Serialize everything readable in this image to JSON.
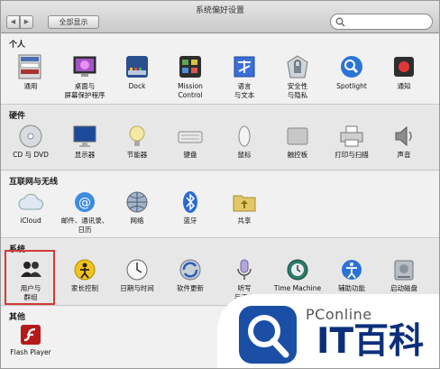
{
  "window": {
    "title": "系统偏好设置",
    "back_glyph": "◀",
    "forward_glyph": "▶",
    "show_all_label": "全部显示"
  },
  "sections": {
    "personal": {
      "title": "个人",
      "items": [
        {
          "label": "通用",
          "icon": "general-icon"
        },
        {
          "label": "桌面与\n屏幕保护程序",
          "icon": "desktop-screensaver-icon"
        },
        {
          "label": "Dock",
          "icon": "dock-icon"
        },
        {
          "label": "Mission\nControl",
          "icon": "mission-control-icon"
        },
        {
          "label": "语言\n与文本",
          "icon": "language-text-icon"
        },
        {
          "label": "安全性\n与隐私",
          "icon": "security-privacy-icon"
        },
        {
          "label": "Spotlight",
          "icon": "spotlight-icon"
        },
        {
          "label": "通知",
          "icon": "notifications-icon"
        }
      ]
    },
    "hardware": {
      "title": "硬件",
      "items": [
        {
          "label": "CD 与 DVD",
          "icon": "cd-dvd-icon"
        },
        {
          "label": "显示器",
          "icon": "displays-icon"
        },
        {
          "label": "节能器",
          "icon": "energy-saver-icon"
        },
        {
          "label": "键盘",
          "icon": "keyboard-icon"
        },
        {
          "label": "鼠标",
          "icon": "mouse-icon"
        },
        {
          "label": "触控板",
          "icon": "trackpad-icon"
        },
        {
          "label": "打印与扫描",
          "icon": "print-scan-icon"
        },
        {
          "label": "声音",
          "icon": "sound-icon"
        }
      ]
    },
    "internet": {
      "title": "互联网与无线",
      "items": [
        {
          "label": "iCloud",
          "icon": "icloud-icon"
        },
        {
          "label": "邮件、通讯录、\n日历",
          "icon": "mail-contacts-calendars-icon"
        },
        {
          "label": "网络",
          "icon": "network-icon"
        },
        {
          "label": "蓝牙",
          "icon": "bluetooth-icon"
        },
        {
          "label": "共享",
          "icon": "sharing-icon"
        }
      ]
    },
    "system": {
      "title": "系统",
      "items": [
        {
          "label": "用户与\n群组",
          "icon": "users-groups-icon"
        },
        {
          "label": "家长控制",
          "icon": "parental-controls-icon"
        },
        {
          "label": "日期与时间",
          "icon": "date-time-icon"
        },
        {
          "label": "软件更新",
          "icon": "software-update-icon"
        },
        {
          "label": "听写\n与语音",
          "icon": "dictation-speech-icon"
        },
        {
          "label": "Time Machine",
          "icon": "time-machine-icon"
        },
        {
          "label": "辅助功能",
          "icon": "accessibility-icon"
        },
        {
          "label": "启动磁盘",
          "icon": "startup-disk-icon"
        }
      ]
    },
    "other": {
      "title": "其他",
      "items": [
        {
          "label": "Flash Player",
          "icon": "flash-player-icon"
        }
      ]
    }
  },
  "watermark": {
    "brand": "PConline",
    "logo_text": "IT百科"
  },
  "colors": {
    "highlight_border": "#d23a3a",
    "watermark_blue": "#1b4fa6",
    "watermark_navy": "#0b2f7a"
  }
}
